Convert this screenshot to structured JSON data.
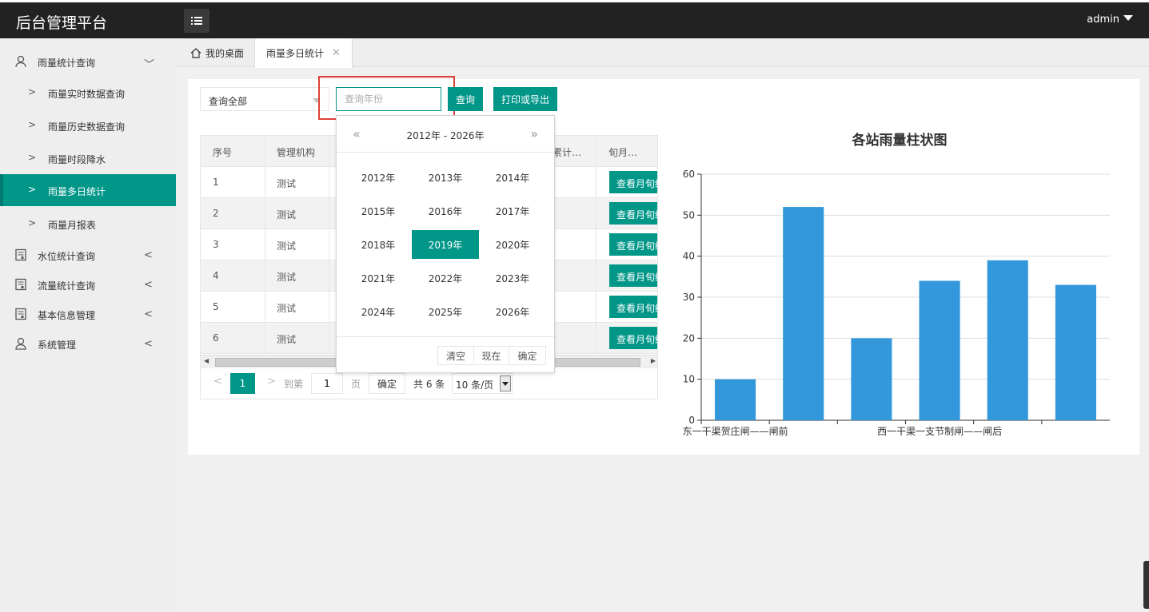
{
  "app": {
    "title": "后台管理平台",
    "user": "admin"
  },
  "sidebar": {
    "groups": [
      {
        "label": "雨量统计查询",
        "expanded": true,
        "icon": "user-icon"
      },
      {
        "label": "水位统计查询",
        "icon": "report-icon"
      },
      {
        "label": "流量统计查询",
        "icon": "report-icon"
      },
      {
        "label": "基本信息管理",
        "icon": "report-icon"
      },
      {
        "label": "系统管理",
        "icon": "users-icon"
      }
    ],
    "sub_items": [
      {
        "label": "雨量实时数据查询"
      },
      {
        "label": "雨量历史数据查询"
      },
      {
        "label": "雨量时段降水"
      },
      {
        "label": "雨量多日统计",
        "active": true
      },
      {
        "label": "雨量月报表"
      }
    ]
  },
  "tabs": [
    {
      "label": "我的桌面",
      "icon": "home-icon"
    },
    {
      "label": "雨量多日统计",
      "closable": true
    }
  ],
  "toolbar": {
    "select_value": "查询全部",
    "year_placeholder": "查询年份",
    "query_label": "查询",
    "print_label": "打印或导出"
  },
  "table": {
    "headers": [
      "序号",
      "管理机构",
      "累计…",
      "旬月…"
    ],
    "rows": [
      {
        "idx": "1",
        "org": "测试",
        "action": "查看月旬统计"
      },
      {
        "idx": "2",
        "org": "测试",
        "action": "查看月旬统计"
      },
      {
        "idx": "3",
        "org": "测试",
        "action": "查看月旬统计"
      },
      {
        "idx": "4",
        "org": "测试",
        "action": "查看月旬统计"
      },
      {
        "idx": "5",
        "org": "测试",
        "action": "查看月旬统计"
      },
      {
        "idx": "6",
        "org": "测试",
        "action": "查看月旬统计"
      }
    ]
  },
  "pager": {
    "current": "1",
    "goto_label": "到第",
    "goto_value": "1",
    "page_label": "页",
    "ok_label": "确定",
    "total": "共 6 条",
    "page_size": "10 条/页"
  },
  "picker": {
    "range": "2012年 - 2026年",
    "years": [
      "2012年",
      "2013年",
      "2014年",
      "2015年",
      "2016年",
      "2017年",
      "2018年",
      "2019年",
      "2020年",
      "2021年",
      "2022年",
      "2023年",
      "2024年",
      "2025年",
      "2026年"
    ],
    "selected": "2019年",
    "clear_label": "清空",
    "now_label": "现在",
    "confirm_label": "确定"
  },
  "chart_data": {
    "type": "bar",
    "title": "各站雨量柱状图",
    "categories": [
      "东一干渠贺庄闸——闸前",
      "",
      "",
      "西一干渠一支节制闸——闸后",
      "",
      ""
    ],
    "values": [
      10,
      52,
      20,
      34,
      39,
      33
    ],
    "ylim": [
      0,
      60
    ],
    "yticks": [
      0,
      10,
      20,
      30,
      40,
      50,
      60
    ],
    "grid": true,
    "color": "#3398db"
  },
  "colors": {
    "accent": "#009688",
    "topbar": "#222222",
    "highlight": "#e0403a"
  }
}
